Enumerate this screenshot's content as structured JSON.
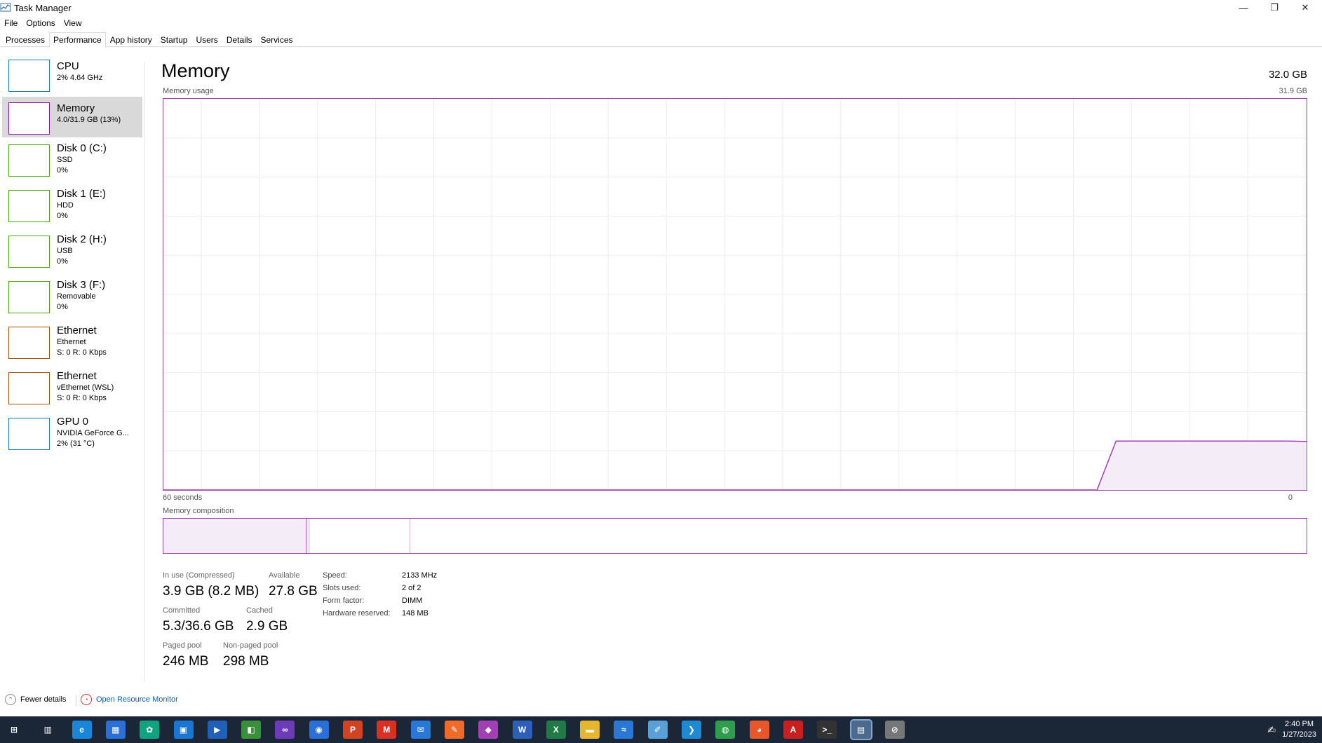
{
  "window": {
    "title": "Task Manager",
    "minimize": "—",
    "restore": "❐",
    "close": "✕"
  },
  "menu": [
    "File",
    "Options",
    "View"
  ],
  "tabs": [
    "Processes",
    "Performance",
    "App history",
    "Startup",
    "Users",
    "Details",
    "Services"
  ],
  "active_tab": "Performance",
  "sidebar": [
    {
      "name": "CPU",
      "line1": "2% 4.64 GHz",
      "line2": "",
      "color": "#117dbb",
      "selected": false
    },
    {
      "name": "Memory",
      "line1": "4.0/31.9 GB (13%)",
      "line2": "",
      "color": "#8b12ae",
      "selected": true
    },
    {
      "name": "Disk 0 (C:)",
      "line1": "SSD",
      "line2": "0%",
      "color": "#4da60c",
      "selected": false
    },
    {
      "name": "Disk 1 (E:)",
      "line1": "HDD",
      "line2": "0%",
      "color": "#4da60c",
      "selected": false
    },
    {
      "name": "Disk 2 (H:)",
      "line1": "USB",
      "line2": "0%",
      "color": "#4da60c",
      "selected": false
    },
    {
      "name": "Disk 3 (F:)",
      "line1": "Removable",
      "line2": "0%",
      "color": "#4da60c",
      "selected": false
    },
    {
      "name": "Ethernet",
      "line1": "Ethernet",
      "line2": "S: 0 R: 0 Kbps",
      "color": "#a74f01",
      "selected": false
    },
    {
      "name": "Ethernet",
      "line1": "vEthernet (WSL)",
      "line2": "S: 0 R: 0 Kbps",
      "color": "#a74f01",
      "selected": false
    },
    {
      "name": "GPU 0",
      "line1": "NVIDIA GeForce G...",
      "line2": "2% (31 °C)",
      "color": "#117dbb",
      "selected": false
    }
  ],
  "main": {
    "title": "Memory",
    "total": "32.0 GB",
    "usage_label": "Memory usage",
    "usage_max": "31.9 GB",
    "time_label": "60 seconds",
    "time_end": "0",
    "composition_label": "Memory composition",
    "accent": "#9d3fb5"
  },
  "stats": {
    "in_use_label": "In use (Compressed)",
    "in_use_value": "3.9 GB (8.2 MB)",
    "available_label": "Available",
    "available_value": "27.8 GB",
    "committed_label": "Committed",
    "committed_value": "5.3/36.6 GB",
    "cached_label": "Cached",
    "cached_value": "2.9 GB",
    "paged_label": "Paged pool",
    "paged_value": "246 MB",
    "nonpaged_label": "Non-paged pool",
    "nonpaged_value": "298 MB"
  },
  "details": [
    {
      "label": "Speed:",
      "value": "2133 MHz"
    },
    {
      "label": "Slots used:",
      "value": "2 of 2"
    },
    {
      "label": "Form factor:",
      "value": "DIMM"
    },
    {
      "label": "Hardware reserved:",
      "value": "148 MB"
    }
  ],
  "footer": {
    "fewer_details": "Fewer details",
    "resource_monitor": "Open Resource Monitor"
  },
  "clock": {
    "time": "2:40 PM",
    "date": "1/27/2023"
  },
  "taskbar_icons": [
    {
      "name": "start-icon",
      "glyph": "⊞",
      "color": "#1b2636"
    },
    {
      "name": "task-view-icon",
      "glyph": "▥",
      "color": "#1b2636"
    },
    {
      "name": "edge-icon",
      "glyph": "e",
      "color": "#1a86d9"
    },
    {
      "name": "store-icon",
      "glyph": "▦",
      "color": "#2a6fd6"
    },
    {
      "name": "chatgpt-icon",
      "glyph": "✿",
      "color": "#10a37f"
    },
    {
      "name": "app-icon-blue",
      "glyph": "▣",
      "color": "#1976d2"
    },
    {
      "name": "media-player-icon",
      "glyph": "▶",
      "color": "#2060b8"
    },
    {
      "name": "app-icon-green",
      "glyph": "◧",
      "color": "#3a8f3a"
    },
    {
      "name": "visual-studio-icon",
      "glyph": "∞",
      "color": "#6c3bb8"
    },
    {
      "name": "app-icon-circle",
      "glyph": "◉",
      "color": "#2a6fd6"
    },
    {
      "name": "powerpoint-icon",
      "glyph": "P",
      "color": "#d04423"
    },
    {
      "name": "gmail-icon",
      "glyph": "M",
      "color": "#d93025"
    },
    {
      "name": "mail-icon",
      "glyph": "✉",
      "color": "#2a78d6"
    },
    {
      "name": "app-icon-orange",
      "glyph": "✎",
      "color": "#f06a2a"
    },
    {
      "name": "app-icon-purple",
      "glyph": "◆",
      "color": "#a33fb5"
    },
    {
      "name": "word-icon",
      "glyph": "W",
      "color": "#2b5fb8"
    },
    {
      "name": "excel-icon",
      "glyph": "X",
      "color": "#1f7a45"
    },
    {
      "name": "file-explorer-icon",
      "glyph": "▬",
      "color": "#e6b62f"
    },
    {
      "name": "app-icon-wave",
      "glyph": "≈",
      "color": "#2a78d6"
    },
    {
      "name": "notepad-icon",
      "glyph": "✐",
      "color": "#5aa0d8"
    },
    {
      "name": "vscode-icon",
      "glyph": "❯",
      "color": "#1f8ad2"
    },
    {
      "name": "chrome-icon",
      "glyph": "◍",
      "color": "#2e9e4b"
    },
    {
      "name": "firefox-icon",
      "glyph": "◕",
      "color": "#e8562a"
    },
    {
      "name": "acrobat-icon",
      "glyph": "A",
      "color": "#c8201f"
    },
    {
      "name": "terminal-icon",
      "glyph": ">_",
      "color": "#333"
    },
    {
      "name": "task-manager-icon",
      "glyph": "▤",
      "color": "#4c6a8c"
    },
    {
      "name": "app-icon-slash",
      "glyph": "⊘",
      "color": "#777"
    }
  ],
  "memory_series": [
    0,
    0,
    0,
    0,
    0,
    0,
    0,
    0,
    0,
    0,
    0,
    0,
    0,
    0,
    0,
    0,
    0,
    0,
    0,
    0,
    0,
    0,
    0,
    0,
    0,
    0,
    0,
    0,
    0,
    0,
    0,
    0,
    0,
    0,
    0,
    0,
    0,
    0,
    0,
    0,
    0,
    0,
    0,
    0,
    0,
    0,
    0,
    0,
    0,
    0,
    0.125,
    0.125,
    0.125,
    0.125,
    0.125,
    0.125,
    0.125,
    0.125,
    0.125,
    0.125,
    0.124
  ]
}
